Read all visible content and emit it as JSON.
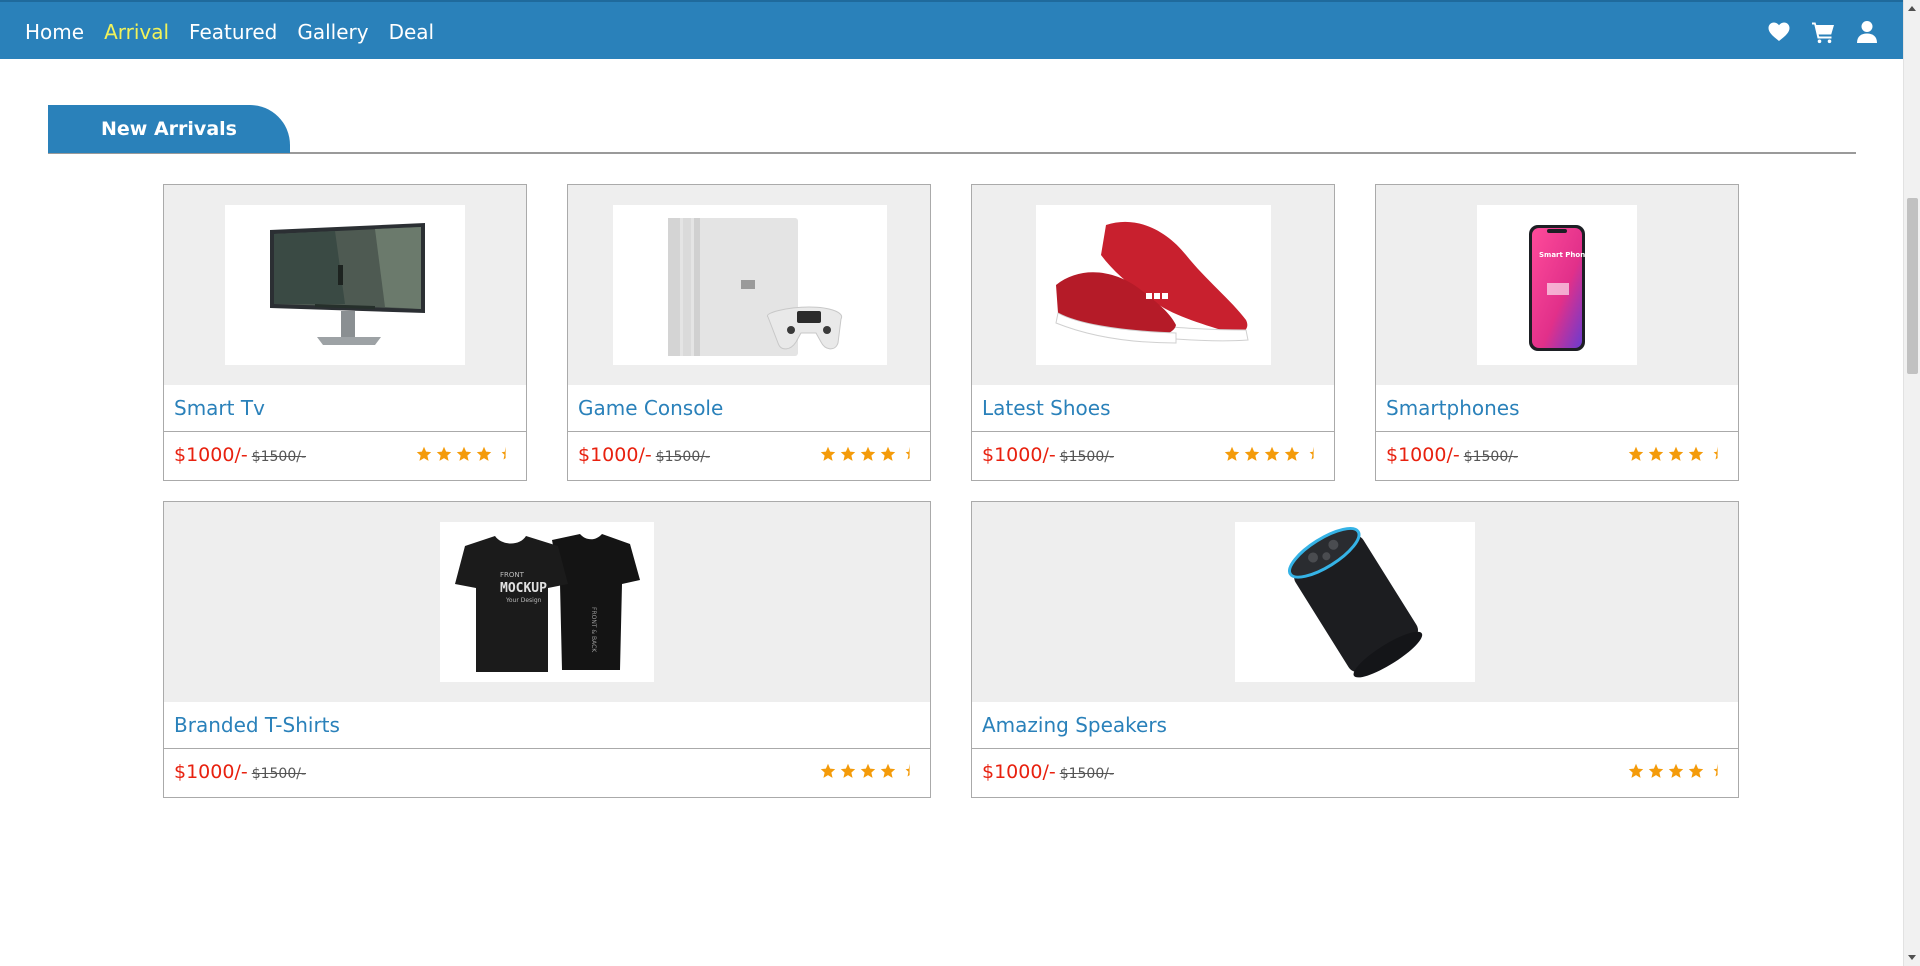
{
  "nav": {
    "links": [
      "Home",
      "Arrival",
      "Featured",
      "Gallery",
      "Deal"
    ],
    "active": "Arrival",
    "active_color": "#f2f25a",
    "icons": [
      "heart-icon",
      "cart-icon",
      "user-icon"
    ]
  },
  "theme": {
    "primary": "#2a81ba",
    "price": "#e8210f",
    "star": "#f49b0a"
  },
  "section": {
    "title": "New Arrivals"
  },
  "products": [
    {
      "title": "Smart Tv",
      "price": "$1000/-",
      "old_price": "$1500/-",
      "rating": 4.5,
      "image": "monitor"
    },
    {
      "title": "Game Console",
      "price": "$1000/-",
      "old_price": "$1500/-",
      "rating": 4.5,
      "image": "game-console"
    },
    {
      "title": "Latest Shoes",
      "price": "$1000/-",
      "old_price": "$1500/-",
      "rating": 4.5,
      "image": "sneakers"
    },
    {
      "title": "Smartphones",
      "price": "$1000/-",
      "old_price": "$1500/-",
      "rating": 4.5,
      "image": "smartphone"
    },
    {
      "title": "Branded T-Shirts",
      "price": "$1000/-",
      "old_price": "$1500/-",
      "rating": 4.5,
      "image": "t-shirts"
    },
    {
      "title": "Amazing Speakers",
      "price": "$1000/-",
      "old_price": "$1500/-",
      "rating": 4.5,
      "image": "speaker"
    }
  ],
  "product_image_text": {
    "phone_screen": "Smart Phone Mockup Psd",
    "tshirt_small": "FRONT",
    "tshirt_main": "MOCKUP",
    "tshirt_sub": "Your Design",
    "tshirt_side": "FRONT & BACK"
  }
}
